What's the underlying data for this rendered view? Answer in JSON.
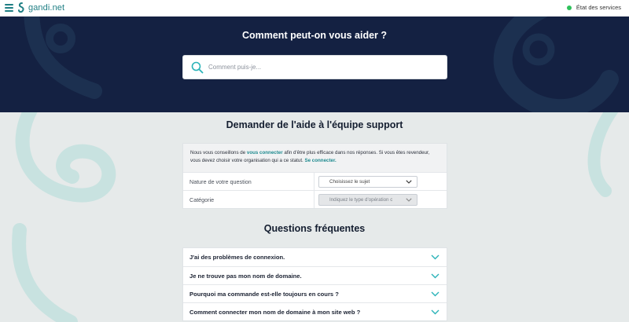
{
  "topbar": {
    "logo_text": "gandi.net",
    "status_label": "État des services",
    "status_color": "#2fc15b"
  },
  "hero": {
    "title": "Comment peut-on vous aider ?",
    "search_placeholder": "Comment puis-je..."
  },
  "support": {
    "title": "Demander de l'aide à l'équipe support",
    "notice": {
      "part1": "Nous vous conseillons de ",
      "link1": "vous connecter",
      "part2": " afin d'être plus efficace dans nos réponses. Si vous êtes revendeur, vous devez choisir votre organisation qui a ce statut. ",
      "link2": "Se connecter."
    },
    "rows": [
      {
        "label": "Nature de votre question",
        "value": "Choisissez le sujet"
      },
      {
        "label": "Catégorie",
        "value": "Indiquez le type d'opération c"
      }
    ]
  },
  "faq": {
    "title": "Questions fréquentes",
    "items": [
      "J'ai des problèmes de connexion.",
      "Je ne trouve pas mon nom de domaine.",
      "Pourquoi ma commande est-elle toujours en cours ?",
      "Comment connecter mon nom de domaine à mon site web ?"
    ]
  },
  "colors": {
    "brand": "#1f7f84",
    "hero_bg": "#142142",
    "page_bg": "#e6eaea",
    "accent": "#2ab3b8"
  }
}
